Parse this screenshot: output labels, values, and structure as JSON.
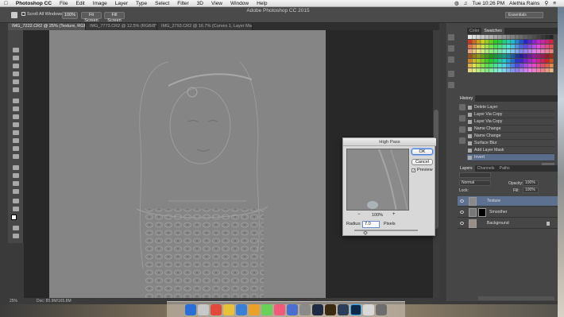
{
  "menubar": {
    "app": "Photoshop CC",
    "items": [
      "File",
      "Edit",
      "Image",
      "Layer",
      "Type",
      "Select",
      "Filter",
      "3D",
      "View",
      "Window",
      "Help"
    ],
    "time": "Tue 10:26 PM",
    "user": "Alethia Rains"
  },
  "optionsbar": {
    "scroll_all": "Scroll All Windows",
    "zoom": "100%",
    "fit_screen": "Fit Screen",
    "fill_screen": "Fill Screen",
    "workspace": "Essentials"
  },
  "window_title": "Adobe Photoshop CC 2015",
  "tabs": [
    "IMG_7222.CR2 @ 25% (Texture, RGB/8*) *",
    "IMG_7773.CR2 @ 12.5% (RGB/8*) *",
    "IMG_2793.CR2 @ 16.7% (Curves 1, Layer Mask/8) *"
  ],
  "status": {
    "zoom": "25%",
    "doc": "Doc: 85.9M/165.8M"
  },
  "swatches_panel": {
    "tabs": [
      "Color",
      "Swatches"
    ]
  },
  "history_panel": {
    "title": "History",
    "items": [
      "Delete Layer",
      "Layer Via Copy",
      "Layer Via Copy",
      "Name Change",
      "Name Change",
      "Surface Blur",
      "Add Layer Mask",
      "Invert"
    ],
    "selected_index": 7
  },
  "layers_panel": {
    "tabs": [
      "Layers",
      "Channels",
      "Paths"
    ],
    "blend_mode": "Normal",
    "opacity_label": "Opacity:",
    "opacity": "100%",
    "lock_label": "Lock:",
    "fill_label": "Fill:",
    "fill": "100%",
    "layers": [
      {
        "name": "Texture",
        "selected": true
      },
      {
        "name": "Smoother",
        "selected": false
      },
      {
        "name": "Background",
        "selected": false
      }
    ]
  },
  "dialog": {
    "title": "High Pass",
    "ok": "OK",
    "cancel": "Cancel",
    "preview_label": "Preview",
    "zoom_out": "−",
    "zoom_level": "100%",
    "zoom_in": "+",
    "radius_label": "Radius:",
    "radius_value": "7.0",
    "units": "Pixels"
  },
  "colors": {
    "accent": "#5d708f",
    "canvas_gray": "#858585"
  }
}
